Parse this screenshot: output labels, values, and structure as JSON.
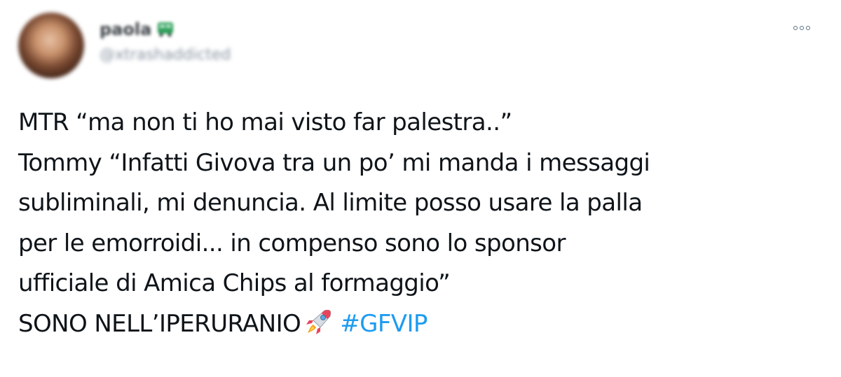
{
  "author": {
    "display_name": "paola",
    "handle": "@xtrashaddicted",
    "badge_icon": "bus-icon"
  },
  "menu": {
    "icon": "more-options-icon"
  },
  "tweet": {
    "lines": [
      "MTR “ma non ti ho mai visto far palestra..”",
      "Tommy “Infatti Givova tra un po’ mi manda i messaggi",
      "subliminali, mi denuncia. Al limite posso usare la palla",
      "per le emorroidi... in compenso sono lo sponsor",
      "ufficiale di Amica Chips al formaggio”"
    ],
    "last_line_text": "SONO NELL’IPERURANIO",
    "emoji": "rocket-icon",
    "hashtag": "#GFVIP"
  },
  "colors": {
    "text": "#0f1419",
    "hashtag": "#1d9bf0",
    "handle": "#8a96a3",
    "icon": "#5b7083"
  }
}
